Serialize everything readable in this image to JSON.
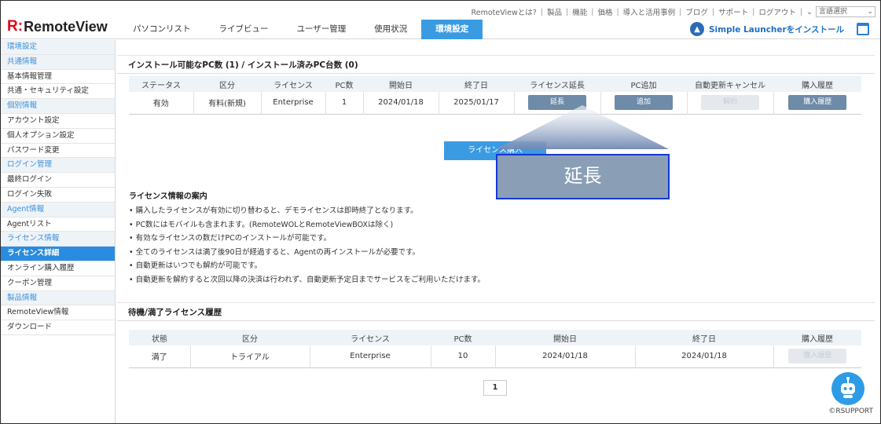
{
  "header": {
    "logo_mark": "R:",
    "logo_text": "RemoteView",
    "top_links": [
      "RemoteViewとは?",
      "製品",
      "機能",
      "価格",
      "導入と活用事例",
      "ブログ",
      "サポート",
      "ログアウト"
    ],
    "lang_select": "言語選択",
    "tabs": [
      "パソコンリスト",
      "ライブビュー",
      "ユーザー管理",
      "使用状況",
      "環境設定"
    ],
    "active_tab": "環境設定",
    "launcher_text": "Simple Launcherをインストール"
  },
  "sidebar": {
    "items": [
      {
        "label": "環境設定",
        "type": "sec"
      },
      {
        "label": "共通情報",
        "type": "sec"
      },
      {
        "label": "基本情報管理",
        "type": "item"
      },
      {
        "label": "共通・セキュリティ設定",
        "type": "item"
      },
      {
        "label": "個別情報",
        "type": "sec"
      },
      {
        "label": "アカウント設定",
        "type": "item"
      },
      {
        "label": "個人オプション設定",
        "type": "item"
      },
      {
        "label": "パスワード変更",
        "type": "item"
      },
      {
        "label": "ログイン管理",
        "type": "sec"
      },
      {
        "label": "最終ログイン",
        "type": "item"
      },
      {
        "label": "ログイン失敗",
        "type": "item"
      },
      {
        "label": "Agent情報",
        "type": "sec"
      },
      {
        "label": "Agentリスト",
        "type": "item"
      },
      {
        "label": "ライセンス情報",
        "type": "sec"
      },
      {
        "label": "ライセンス詳細",
        "type": "active"
      },
      {
        "label": "オンライン購入履歴",
        "type": "item"
      },
      {
        "label": "クーポン管理",
        "type": "item"
      },
      {
        "label": "製品情報",
        "type": "sec"
      },
      {
        "label": "RemoteView情報",
        "type": "item"
      },
      {
        "label": "ダウンロード",
        "type": "item"
      }
    ]
  },
  "main": {
    "title": "インストール可能なPC数 (1) / インストール済みPC台数 (0)",
    "table1": {
      "headers": [
        "ステータス",
        "区分",
        "ライセンス",
        "PC数",
        "開始日",
        "終了日",
        "ライセンス延長",
        "PC追加",
        "自動更新キャンセル",
        "購入履歴"
      ],
      "row": {
        "status": "有効",
        "category": "有料(新規)",
        "license": "Enterprise",
        "pc": "1",
        "start": "2024/01/18",
        "end": "2025/01/17",
        "extend": "延長",
        "add": "追加",
        "cancel": "解約",
        "history": "購入履歴"
      }
    },
    "buy_button": "ライセンス購入",
    "callout": "延長",
    "guide_title": "ライセンス情報の案内",
    "guide": [
      "• 購入したライセンスが有効に切り替わると、デモライセンスは即時終了となります。",
      "• PC数にはモバイルも含まれます。(RemoteWOLとRemoteViewBOXは除く)",
      "• 有効なライセンスの数だけPCのインストールが可能です。",
      "• 全てのライセンスは満了後90日が経過すると、Agentの再インストールが必要です。",
      "• 自動更新はいつでも解約が可能です。",
      "• 自動更新を解約すると次回以降の決済は行われず、自動更新予定日までサービスをご利用いただけます。"
    ],
    "history_title": "待機/満了ライセンス履歴",
    "table2": {
      "headers": [
        "状態",
        "区分",
        "ライセンス",
        "PC数",
        "開始日",
        "終了日",
        "購入履歴"
      ],
      "row": {
        "status": "満了",
        "category": "トライアル",
        "license": "Enterprise",
        "pc": "10",
        "start": "2024/01/18",
        "end": "2024/01/18",
        "history": "購入履歴"
      }
    },
    "page": "1"
  },
  "copyright": "©RSUPPORT",
  "colors": {
    "accent": "#3b9be2",
    "brand_red": "#e60012",
    "callout_border": "#1437d8"
  }
}
